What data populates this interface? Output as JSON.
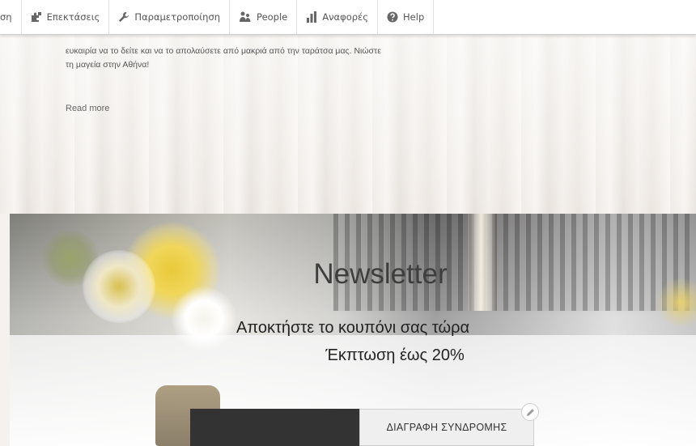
{
  "toolbar": {
    "items": [
      {
        "label": "ση",
        "icon": "partial-item"
      },
      {
        "label": "Επεκτάσεις",
        "icon": "puzzle-icon"
      },
      {
        "label": "Παραμετροποίηση",
        "icon": "wrench-icon"
      },
      {
        "label": "People",
        "icon": "people-icon"
      },
      {
        "label": "Αναφορές",
        "icon": "bar-chart-icon"
      },
      {
        "label": "Help",
        "icon": "help-icon"
      }
    ]
  },
  "article": {
    "text_line1": "ευκαιρία να το δείτε και να το απολαύσετε από μακριά από την ταράτσα μας. Νιώστε",
    "text_line2": "τη μαγεία στην Αθήνα!",
    "read_more": "Read more"
  },
  "newsletter": {
    "title": "Newsletter",
    "subtitle_line1": "Αποκτήστε το κουπόνι σας τώρα",
    "subtitle_line2": "Έκπτωση έως 20%",
    "input_value": "",
    "button_label": "ΔΙΑΓΡΑΦΗ ΣΥΝΔΡΟΜΗΣ"
  },
  "colors": {
    "toolbar_bg": "#ffffff",
    "form_dark": "#333333",
    "button_bg": "#efefef"
  }
}
